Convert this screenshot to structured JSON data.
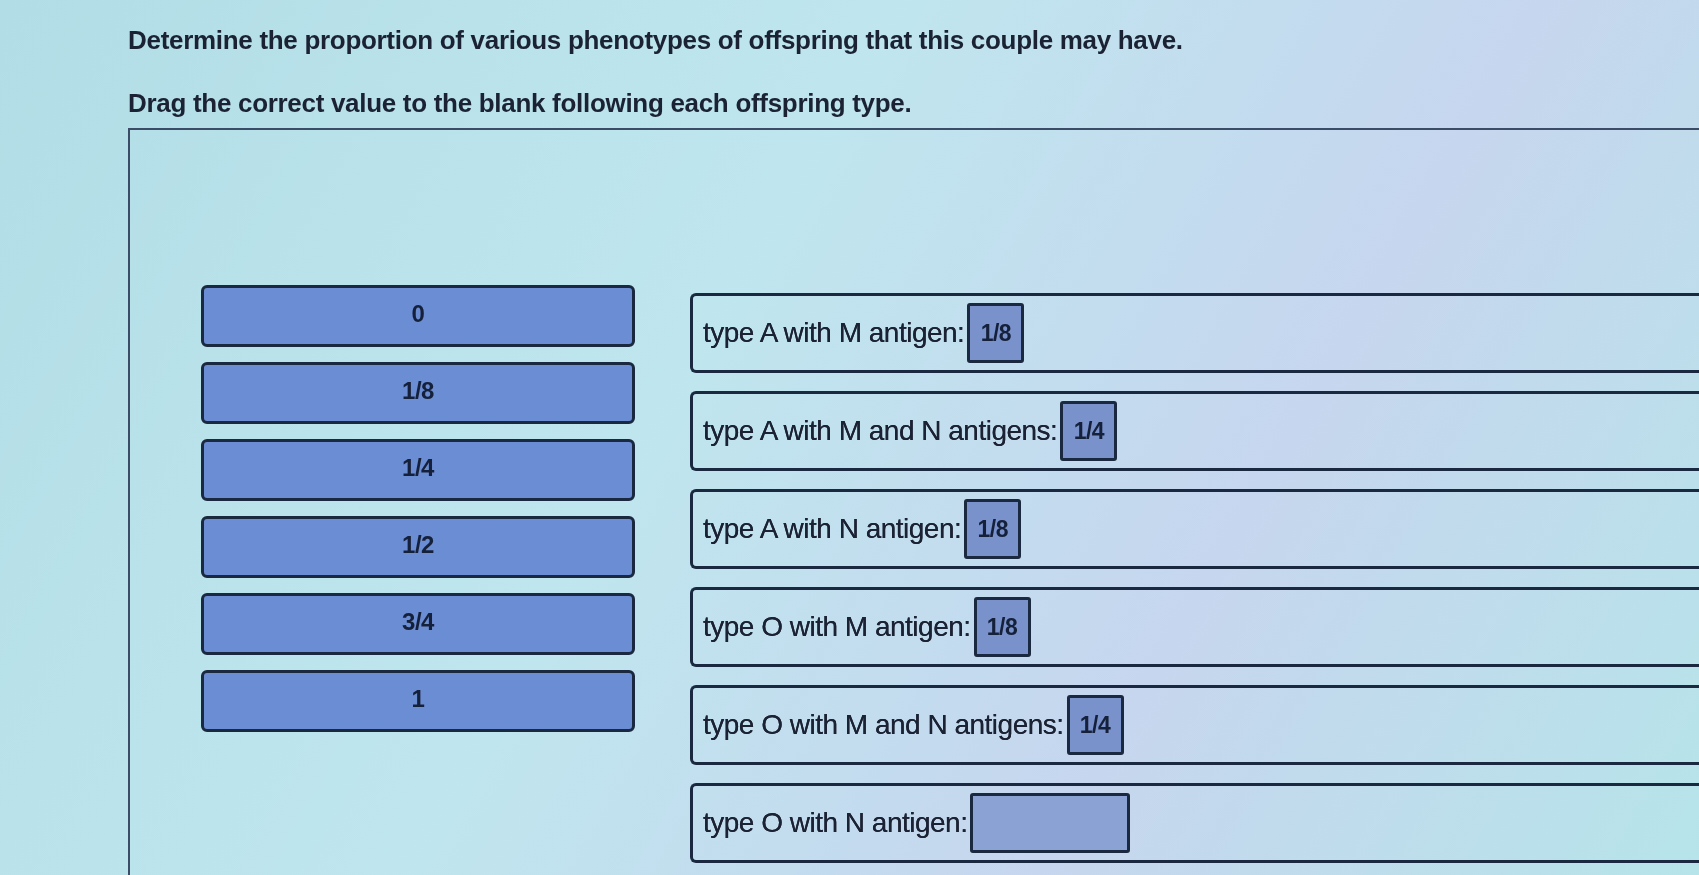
{
  "instructions": [
    "Determine the proportion of various phenotypes of offspring that this couple may have.",
    "Drag the correct value to the blank following each offspring type."
  ],
  "choices": [
    "0",
    "1/8",
    "1/4",
    "1/2",
    "3/4",
    "1"
  ],
  "targets": [
    {
      "label": "type A with M antigen:",
      "answer": "1/8"
    },
    {
      "label": "type A with M and N antigens:",
      "answer": "1/4"
    },
    {
      "label": "type A with N antigen:",
      "answer": "1/8"
    },
    {
      "label": "type O with M antigen:",
      "answer": "1/8"
    },
    {
      "label": "type O with M and N antigens:",
      "answer": "1/4"
    },
    {
      "label": "type O with N antigen:"
    }
  ]
}
